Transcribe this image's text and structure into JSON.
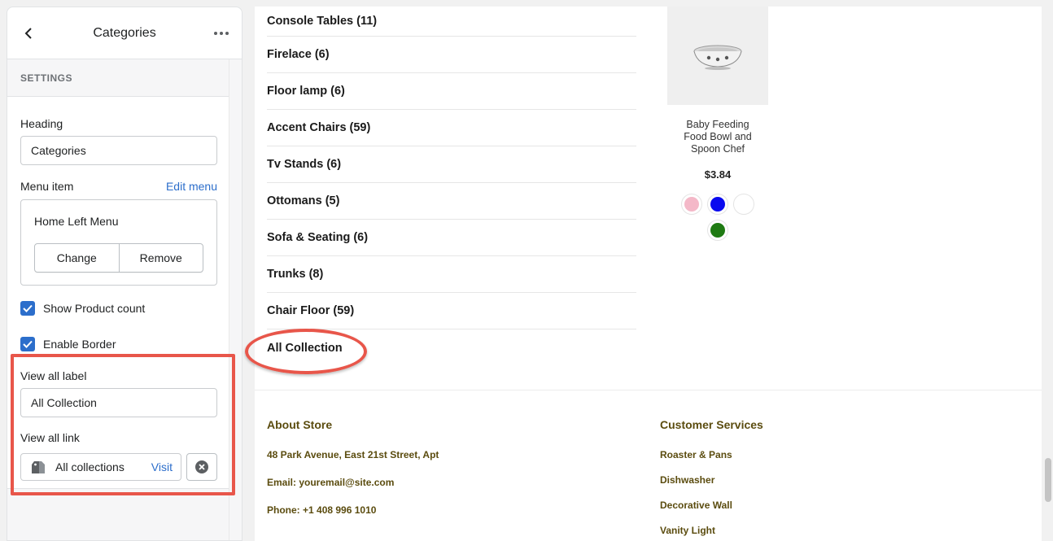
{
  "sidebar": {
    "title": "Categories",
    "section_label": "SETTINGS",
    "heading_label": "Heading",
    "heading_value": "Categories",
    "menu_item_label": "Menu item",
    "edit_menu_link": "Edit menu",
    "menu_name": "Home Left Menu",
    "change_button": "Change",
    "remove_button": "Remove",
    "show_product_count_label": "Show Product count",
    "show_product_count_checked": true,
    "enable_border_label": "Enable Border",
    "enable_border_checked": true,
    "view_all_label_label": "View all label",
    "view_all_label_value": "All Collection",
    "view_all_link_label": "View all link",
    "view_all_link_value": "All collections",
    "visit_link": "Visit",
    "accent_color": "#2c6ecb"
  },
  "preview": {
    "categories": [
      "Console Tables (11)",
      "Firelace (6)",
      "Floor lamp (6)",
      "Accent Chairs (59)",
      "Tv Stands (6)",
      "Ottomans (5)",
      "Sofa & Seating (6)",
      "Trunks (8)",
      "Chair Floor (59)",
      "All Collection"
    ],
    "product": {
      "name_line1": "Baby Feeding",
      "name_line2": "Food Bowl and",
      "name_line3": "Spoon Chef",
      "price": "$3.84",
      "swatches": [
        "#f4b8c8",
        "#0a0aef",
        "#ffffff",
        "#1e7a12"
      ]
    },
    "footer": {
      "about_heading": "About Store",
      "about_items": [
        "48 Park Avenue, East 21st Street, Apt",
        "Email: youremail@site.com",
        "Phone: +1 408 996 1010"
      ],
      "services_heading": "Customer Services",
      "services_items": [
        "Roaster & Pans",
        "Dishwasher",
        "Decorative Wall",
        "Vanity Light"
      ],
      "text_color": "#5b4c0f"
    },
    "annotation_color": "#e8564a"
  }
}
